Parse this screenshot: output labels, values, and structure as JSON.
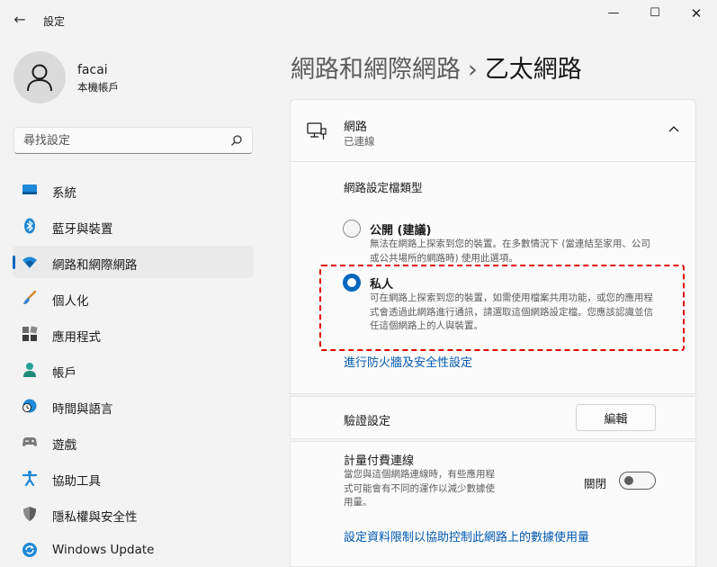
{
  "window": {
    "app_title": "設定",
    "back_glyph": "←",
    "minimize_glyph": "—",
    "maximize_glyph": "☐",
    "close_glyph": "✕"
  },
  "user": {
    "name": "facai",
    "account_type": "本機帳戶"
  },
  "search": {
    "placeholder": "尋找設定"
  },
  "sidebar": {
    "items": [
      {
        "label": "系統",
        "icon": "system-icon",
        "active": false
      },
      {
        "label": "藍牙與裝置",
        "icon": "bluetooth-icon",
        "active": false
      },
      {
        "label": "網路和網際網路",
        "icon": "network-icon",
        "active": true
      },
      {
        "label": "個人化",
        "icon": "personalization-icon",
        "active": false
      },
      {
        "label": "應用程式",
        "icon": "apps-icon",
        "active": false
      },
      {
        "label": "帳戶",
        "icon": "accounts-icon",
        "active": false
      },
      {
        "label": "時間與語言",
        "icon": "time-language-icon",
        "active": false
      },
      {
        "label": "遊戲",
        "icon": "gaming-icon",
        "active": false
      },
      {
        "label": "協助工具",
        "icon": "accessibility-icon",
        "active": false
      },
      {
        "label": "隱私權與安全性",
        "icon": "privacy-shield-icon",
        "active": false
      },
      {
        "label": "Windows Update",
        "icon": "windows-update-icon",
        "active": false
      }
    ]
  },
  "breadcrumb": {
    "parent": "網路和網際網路",
    "separator": "›",
    "current": "乙太網路"
  },
  "network_card": {
    "title": "網路",
    "status": "已連線"
  },
  "profile": {
    "label": "網路設定檔類型",
    "public_title": "公開 (建議)",
    "public_desc": "無法在網路上探索到您的裝置。在多數情況下 (當連結至家用、公司或公共場所的網路時) 使用此選項。",
    "private_title": "私人",
    "private_desc": "可在網路上探索到您的裝置，如需使用檔案共用功能，或您的應用程式會透過此網路進行通訊，請選取這個網路設定檔。您應該認識並信任這個網路上的人與裝置。",
    "selected": "private"
  },
  "firewall_link": "進行防火牆及安全性設定",
  "auth": {
    "label": "驗證設定",
    "edit_label": "編輯"
  },
  "metered": {
    "title": "計量付費連線",
    "desc": "當您與這個網路連線時，有些應用程式可能會有不同的運作以減少數據使用量。",
    "toggle_label": "關閉",
    "on": false
  },
  "data_limit_link": "設定資料限制以協助控制此網路上的數據使用量",
  "colors": {
    "accent": "#0067c0",
    "link": "#0058b0",
    "highlight": "#e00000"
  }
}
